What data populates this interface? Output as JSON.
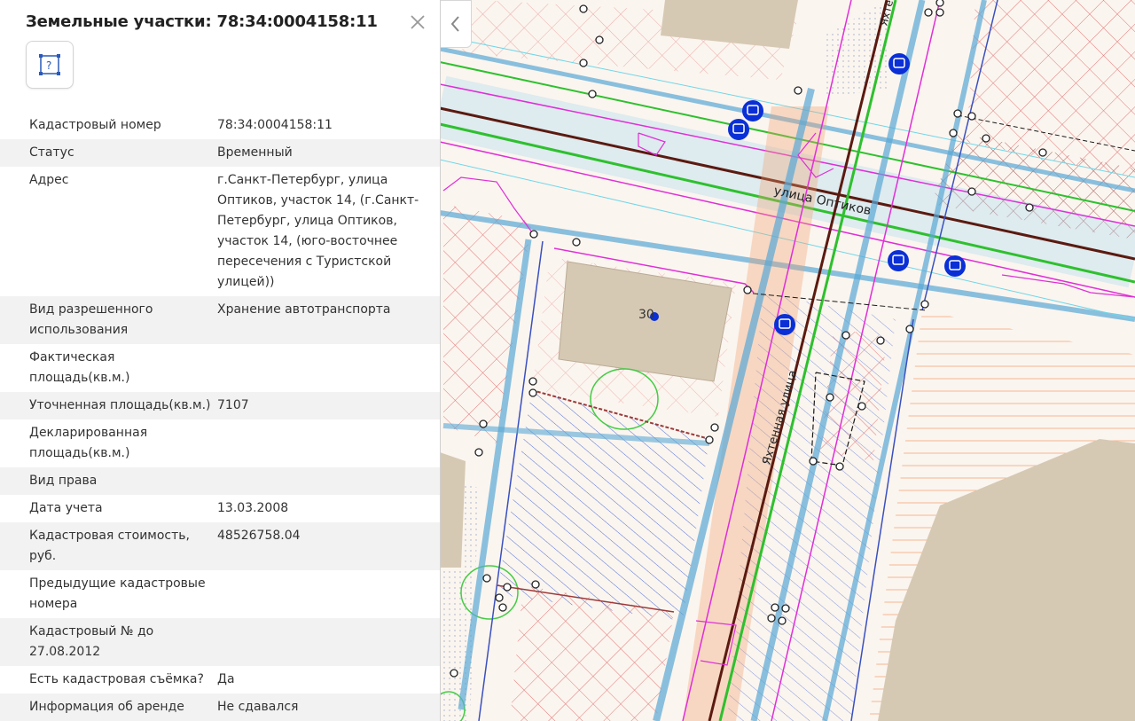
{
  "panel": {
    "title": "Земельные участки: 78:34:0004158:11",
    "close_icon": "close-icon",
    "parcel_icon": "parcel-question-icon",
    "rows": [
      {
        "label": "Кадастровый номер",
        "value": "78:34:0004158:11"
      },
      {
        "label": "Статус",
        "value": "Временный"
      },
      {
        "label": "Адрес",
        "value": "г.Санкт-Петербург, улица Оптиков, участок 14, (г.Санкт-Петербург, улица Оптиков, участок 14, (юго-восточнее пересечения с Туристской улицей))"
      },
      {
        "label": "Вид разрешенного использования",
        "value": "Хранение автотранспорта"
      },
      {
        "label": "Фактическая площадь(кв.м.)",
        "value": ""
      },
      {
        "label": "Уточненная площадь(кв.м.)",
        "value": "7107"
      },
      {
        "label": "Декларированная площадь(кв.м.)",
        "value": ""
      },
      {
        "label": "Вид права",
        "value": ""
      },
      {
        "label": "Дата учета",
        "value": "13.03.2008"
      },
      {
        "label": "Кадастровая стоимость, руб.",
        "value": "48526758.04"
      },
      {
        "label": "Предыдущие кадастровые номера",
        "value": ""
      },
      {
        "label": "Кадастровый № до 27.08.2012",
        "value": ""
      },
      {
        "label": "Есть кадастровая съёмка?",
        "value": "Да"
      },
      {
        "label": "Информация об аренде",
        "value": "Не сдавался"
      }
    ]
  },
  "map": {
    "street_optikov": "улица Оптиков",
    "street_yakhtennaya": "Яхтенная улица",
    "street_top": "Яхтенная",
    "building_number": "30",
    "collapse_icon": "chevron-left-icon",
    "bus_stop_icon": "bus-stop-icon",
    "colors": {
      "road_blue": "#5aa9d6",
      "parcel_magenta": "#e02ed8",
      "hatch_red": "#e06a6a",
      "hatch_blue": "#4a6fd6",
      "green_line": "#33cc33",
      "building": "#d8cbb8",
      "stop_blue": "#0a2fd6",
      "orange_strip": "#f0a070"
    }
  }
}
